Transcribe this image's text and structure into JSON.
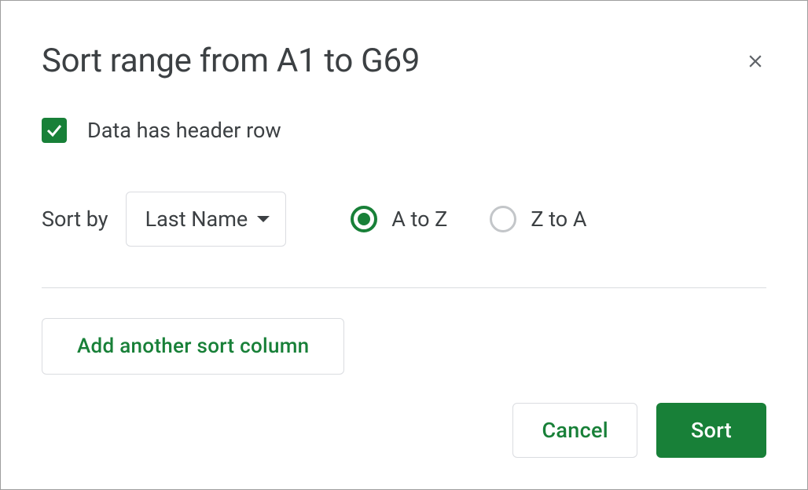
{
  "dialog": {
    "title": "Sort range from A1 to G69",
    "header_checkbox": {
      "checked": true,
      "label": "Data has header row"
    },
    "sort_by_label": "Sort by",
    "sort_by_value": "Last Name",
    "radio_options": {
      "asc": "A to Z",
      "desc": "Z to A",
      "selected": "asc"
    },
    "add_column_label": "Add another sort column",
    "cancel_label": "Cancel",
    "sort_label": "Sort"
  }
}
